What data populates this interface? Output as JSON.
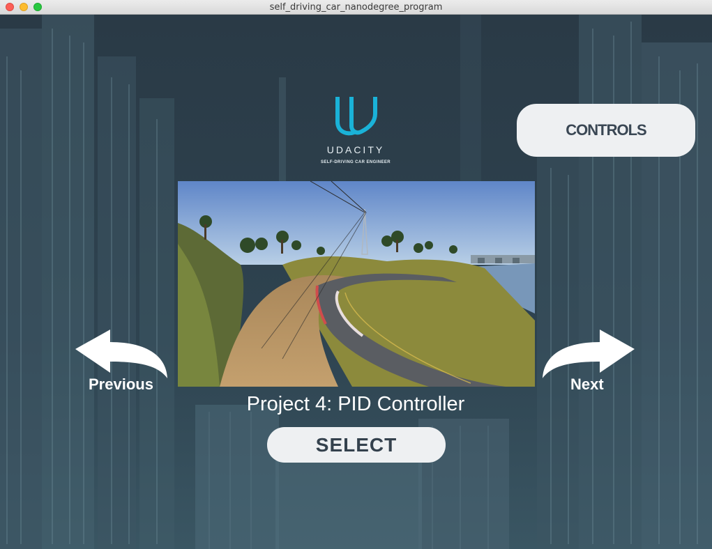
{
  "window": {
    "title": "self_driving_car_nanodegree_program",
    "controls": [
      "close",
      "minimize",
      "zoom"
    ]
  },
  "logo": {
    "icon": "udacity-u-logo-icon",
    "word": "UDACITY",
    "tagline": "SELF-DRIVING CAR ENGINEER",
    "color": "#1ab2d8"
  },
  "controls_button": {
    "label": "CONTROLS"
  },
  "nav": {
    "previous_label": "Previous",
    "next_label": "Next"
  },
  "project": {
    "title": "Project 4: PID Controller",
    "preview": "race-track-scene"
  },
  "select_button": {
    "label": "SELECT"
  },
  "colors": {
    "background": "#2b3b47",
    "button_bg": "#eef0f2",
    "button_text": "#3a4754"
  }
}
